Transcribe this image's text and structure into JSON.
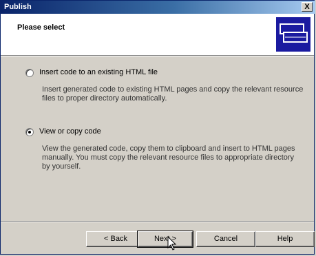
{
  "window": {
    "title": "Publish",
    "close_label": "X"
  },
  "header": {
    "title": "Please select",
    "icon": "publish-window-icon"
  },
  "options": [
    {
      "label": "Insert code to an existing HTML file",
      "selected": false,
      "description": "Insert generated code to existing HTML pages and copy the relevant resource files to proper directory automatically."
    },
    {
      "label": "View or copy code",
      "selected": true,
      "description": "View the generated code, copy them to clipboard and insert to HTML pages manually. You must copy the relevant resource files to appropriate directory by yourself."
    }
  ],
  "buttons": {
    "back": "< Back",
    "next": "Next >",
    "cancel": "Cancel",
    "help": "Help"
  },
  "colors": {
    "title_bar": "#0a246a",
    "dialog_bg": "#d4d0c8",
    "icon_bg": "#1a1aa0"
  }
}
